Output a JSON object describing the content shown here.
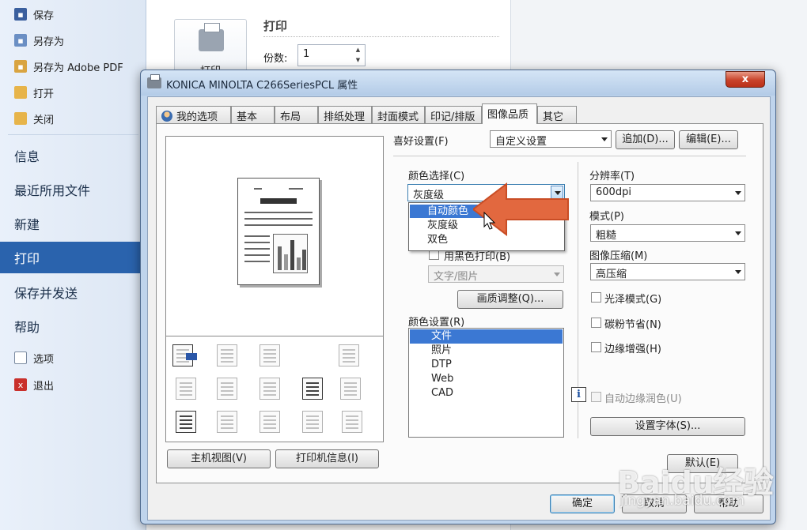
{
  "backstage": {
    "small_items_top": [
      {
        "label": "保存",
        "icon": "save-icon"
      },
      {
        "label": "另存为",
        "icon": "save-as-icon"
      },
      {
        "label": "另存为 Adobe PDF",
        "icon": "pdf-icon"
      },
      {
        "label": "打开",
        "icon": "folder-open-icon"
      },
      {
        "label": "关闭",
        "icon": "folder-close-icon"
      }
    ],
    "big_items": [
      {
        "label": "信息"
      },
      {
        "label": "最近所用文件"
      },
      {
        "label": "新建"
      },
      {
        "label": "打印",
        "active": true
      },
      {
        "label": "保存并发送"
      },
      {
        "label": "帮助"
      }
    ],
    "small_items_bottom": [
      {
        "label": "选项",
        "icon": "options-icon"
      },
      {
        "label": "退出",
        "icon": "exit-icon"
      }
    ]
  },
  "print_panel": {
    "print_button_label": "打印",
    "heading": "打印",
    "copies_label": "份数:",
    "copies_value": "1"
  },
  "dialog": {
    "title": "KONICA MINOLTA C266SeriesPCL 属性",
    "close_glyph": "x",
    "tabs": [
      {
        "label": "我的选项"
      },
      {
        "label": "基本"
      },
      {
        "label": "布局"
      },
      {
        "label": "排纸处理"
      },
      {
        "label": "封面模式"
      },
      {
        "label": "印记/排版"
      },
      {
        "label": "图像品质",
        "active": true
      },
      {
        "label": "其它"
      }
    ],
    "preview_buttons": {
      "host_view": "主机视图(V)",
      "printer_info": "打印机信息(I)"
    },
    "favorites": {
      "label": "喜好设置(F)",
      "value": "自定义设置",
      "add_label": "追加(D)...",
      "edit_label": "编辑(E)..."
    },
    "color_select": {
      "label": "颜色选择(C)",
      "value": "灰度级",
      "options": [
        "自动颜色",
        "灰度级",
        "双色"
      ],
      "highlighted": "自动颜色"
    },
    "print_black_label": "用黑色打印(B)",
    "text_image_value": "文字/图片",
    "quality_adjust_label": "画质调整(Q)...",
    "color_settings": {
      "label": "颜色设置(R)",
      "items": [
        "文件",
        "照片",
        "DTP",
        "Web",
        "CAD"
      ],
      "selected": "文件"
    },
    "resolution": {
      "label": "分辨率(T)",
      "value": "600dpi"
    },
    "mode": {
      "label": "模式(P)",
      "value": "粗糙"
    },
    "compression": {
      "label": "图像压缩(M)",
      "value": "高压缩"
    },
    "checkboxes": {
      "gloss": "光泽模式(G)",
      "toner_save": "碳粉节省(N)",
      "edge_enhance": "边缘增强(H)",
      "auto_trap": "自动边缘润色(U)"
    },
    "info_glyph": "i",
    "font_settings_label": "设置字体(S)...",
    "default_label": "默认(E)",
    "ok_label": "确定",
    "cancel_label": "取消",
    "help_label": "帮助"
  },
  "watermark": {
    "brand": "Baidu经验",
    "url": "jingyan.baidu.com"
  }
}
